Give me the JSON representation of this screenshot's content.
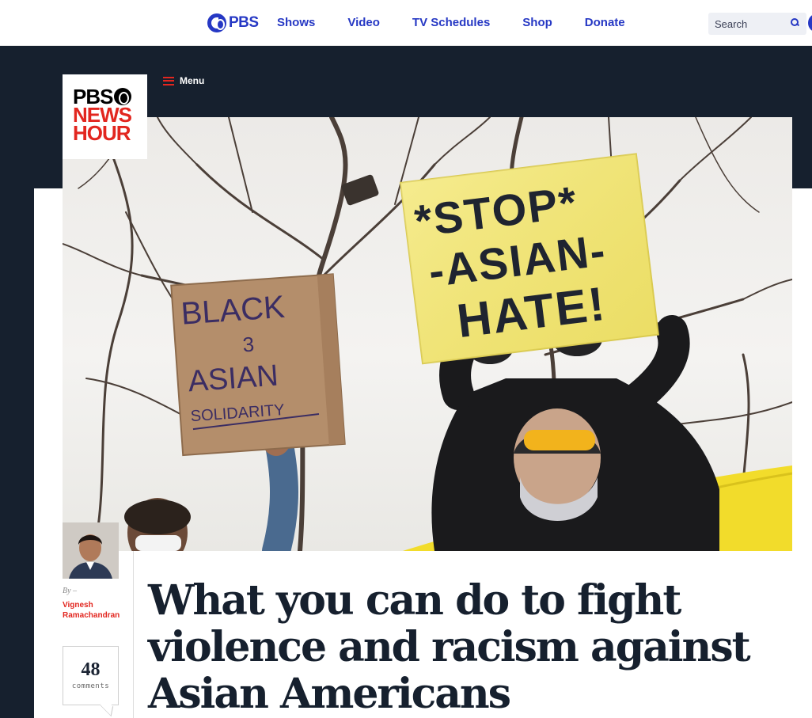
{
  "pbs_header": {
    "logo_text": "PBS",
    "nav": [
      "Shows",
      "Video",
      "TV Schedules",
      "Shop",
      "Donate"
    ],
    "search_placeholder": "Search"
  },
  "newshour": {
    "logo_lines": [
      "PBS",
      "NEWS",
      "HOUR"
    ],
    "menu_label": "Menu"
  },
  "hero": {
    "sign_left_lines": [
      "BLACK",
      "3",
      "ASIAN",
      "SOLIDARITY"
    ],
    "sign_right_lines": [
      "*STOP*",
      "-ASIAN-",
      "HATE!"
    ]
  },
  "byline": {
    "prefix": "By –",
    "author": "Vignesh Ramachandran"
  },
  "comments": {
    "count": "48",
    "label": "comments"
  },
  "article": {
    "headline": "What you can do to fight violence and racism against Asian Americans"
  },
  "colors": {
    "pbs_blue": "#2638c4",
    "newshour_red": "#e2261f",
    "navy": "#16202e"
  }
}
